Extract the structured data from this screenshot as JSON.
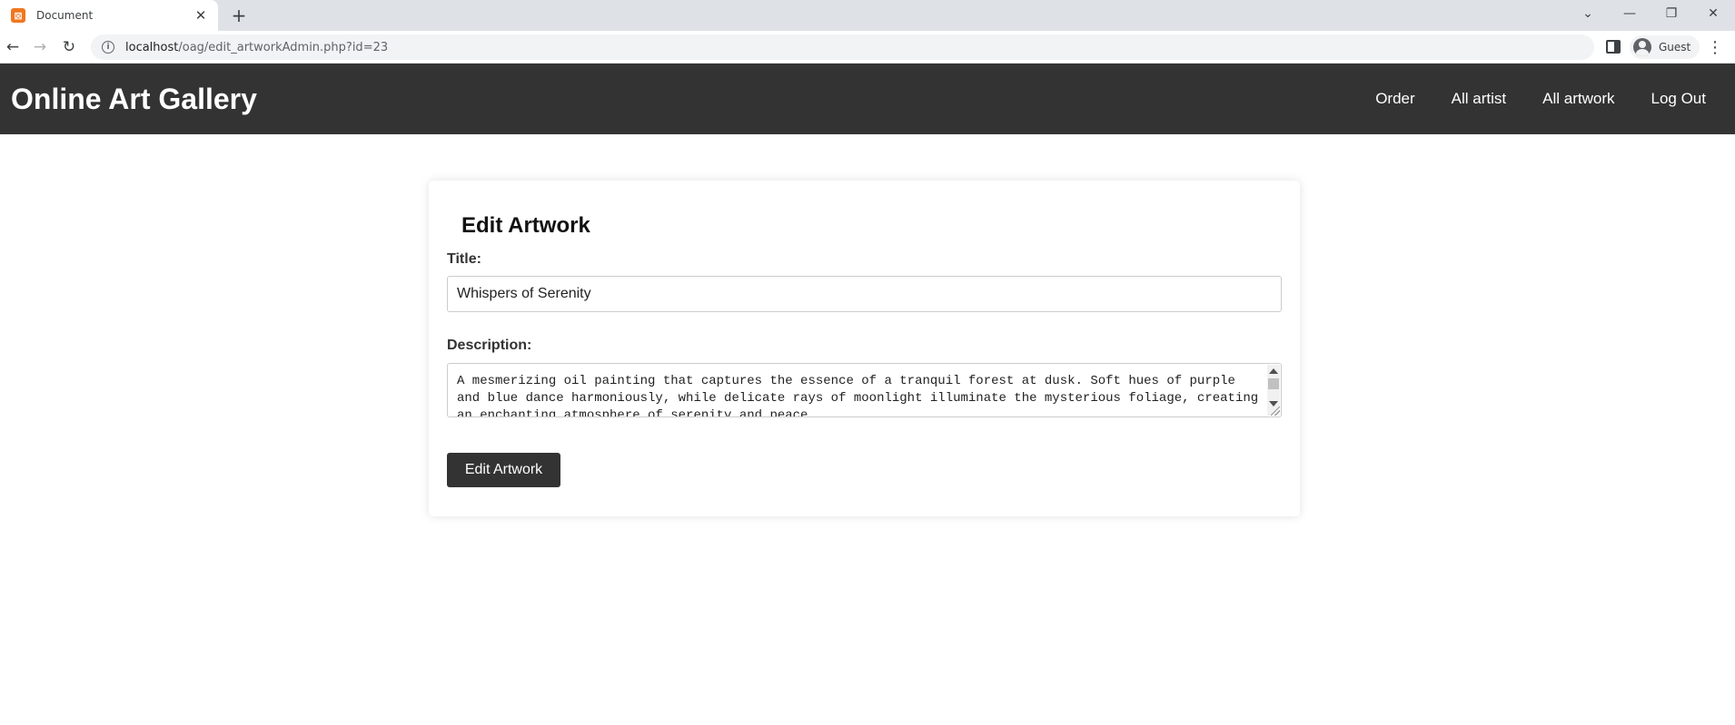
{
  "browser": {
    "tab_title": "Document",
    "tab_favicon": "xampp-icon",
    "url_host": "localhost",
    "url_path": "/oag/edit_artworkAdmin.php?id=23",
    "profile_label": "Guest"
  },
  "site": {
    "logo": "Online Art Gallery",
    "nav": [
      "Order",
      "All artist",
      "All artwork",
      "Log Out"
    ],
    "header_color": "#333333"
  },
  "form": {
    "heading": "Edit Artwork",
    "title_label": "Title:",
    "title_value": "Whispers of Serenity",
    "description_label": "Description:",
    "description_value": "A mesmerizing oil painting that captures the essence of a tranquil forest at dusk. Soft hues of purple and blue dance harmoniously, while delicate rays of moonlight illuminate the mysterious foliage, creating an enchanting atmosphere of serenity and peace.",
    "submit_label": "Edit Artwork"
  }
}
